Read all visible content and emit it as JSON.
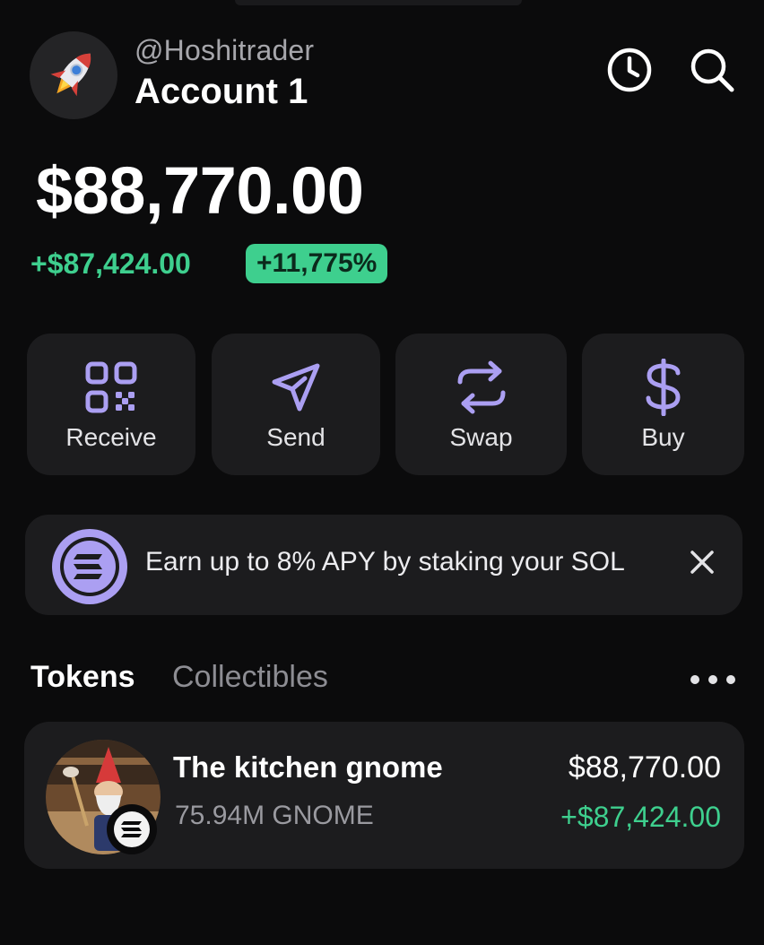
{
  "header": {
    "username": "@Hoshitrader",
    "account_name": "Account 1",
    "avatar_icon": "rocket-icon",
    "history_icon": "clock-icon",
    "search_icon": "search-icon"
  },
  "balance": {
    "total": "$88,770.00",
    "change_amount": "+$87,424.00",
    "change_percent": "+11,775%"
  },
  "actions": [
    {
      "label": "Receive",
      "icon": "qr-code-icon"
    },
    {
      "label": "Send",
      "icon": "send-arrow-icon"
    },
    {
      "label": "Swap",
      "icon": "swap-arrows-icon"
    },
    {
      "label": "Buy",
      "icon": "dollar-icon"
    }
  ],
  "banner": {
    "text": "Earn up to 8% APY by staking your SOL",
    "icon": "solana-logo-icon",
    "close_icon": "close-icon"
  },
  "tabs": [
    {
      "label": "Tokens",
      "active": true
    },
    {
      "label": "Collectibles",
      "active": false
    }
  ],
  "tokens": [
    {
      "name": "The kitchen gnome",
      "amount": "75.94M GNOME",
      "value": "$88,770.00",
      "change": "+$87,424.00",
      "chain_icon": "solana-badge-icon"
    }
  ],
  "colors": {
    "background": "#0b0b0c",
    "card": "#1c1c1e",
    "accent_purple": "#ab9ff2",
    "positive_green": "#3ecf8e",
    "muted_text": "#9a9aa0"
  }
}
